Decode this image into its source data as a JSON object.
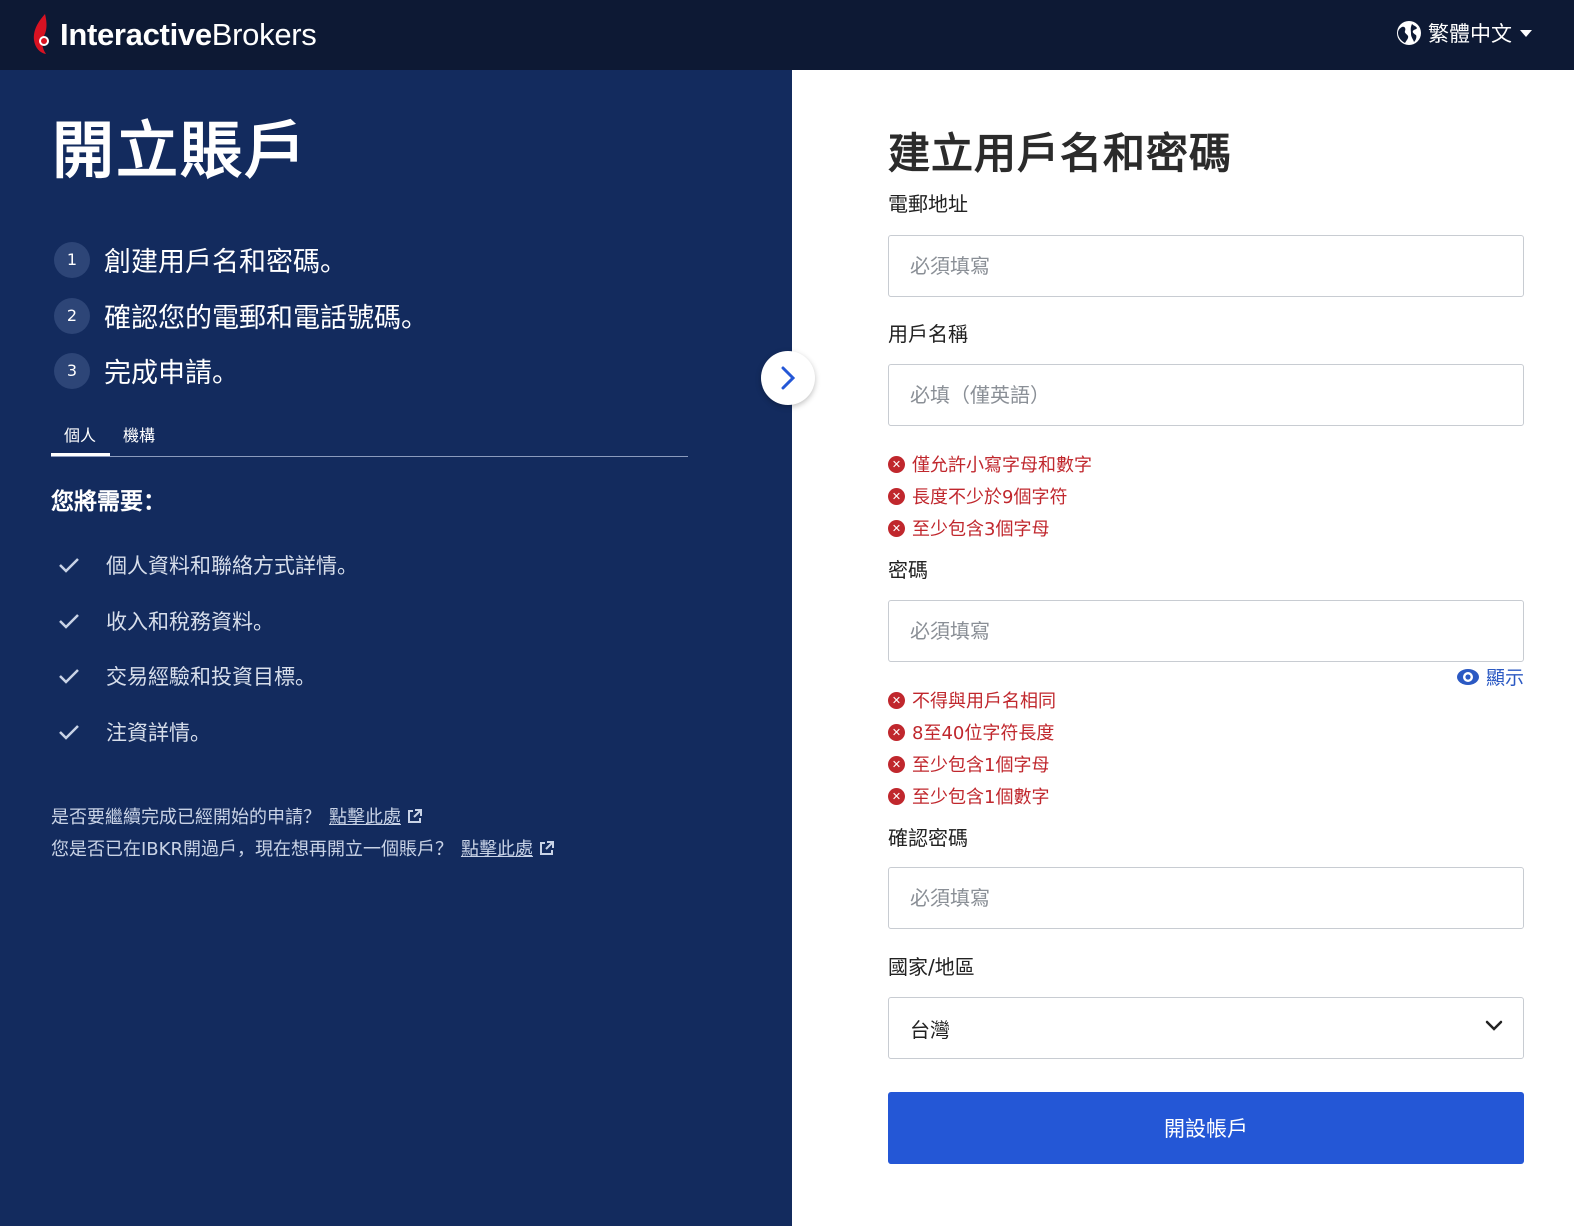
{
  "header": {
    "brand_part1": "Interactive",
    "brand_part2": "Brokers",
    "language": "繁體中文"
  },
  "left": {
    "title": "開立賬戶",
    "steps": [
      {
        "num": "1",
        "text": "創建用戶名和密碼。"
      },
      {
        "num": "2",
        "text": "確認您的電郵和電話號碼。"
      },
      {
        "num": "3",
        "text": "完成申請。"
      }
    ],
    "tabs": [
      {
        "label": "個人",
        "active": true
      },
      {
        "label": "機構",
        "active": false
      }
    ],
    "need_title": "您將需要：",
    "needs": [
      "個人資料和聯絡方式詳情。",
      "收入和稅務資料。",
      "交易經驗和投資目標。",
      "注資詳情。"
    ],
    "links": [
      {
        "text": "是否要繼續完成已經開始的申請？",
        "link": "點擊此處"
      },
      {
        "text": "您是否已在IBKR開過戶，現在想再開立一個賬戶？",
        "link": "點擊此處"
      }
    ]
  },
  "form": {
    "title": "建立用戶名和密碼",
    "email_label": "電郵地址",
    "email_placeholder": "必須填寫",
    "username_label": "用戶名稱",
    "username_placeholder": "必填（僅英語）",
    "username_errors": [
      "僅允許小寫字母和數字",
      "長度不少於9個字符",
      "至少包含3個字母"
    ],
    "password_label": "密碼",
    "password_placeholder": "必須填寫",
    "show_label": "顯示",
    "password_errors": [
      "不得與用戶名相同",
      "8至40位字符長度",
      "至少包含1個字母",
      "至少包含1個數字"
    ],
    "confirm_label": "確認密碼",
    "confirm_placeholder": "必須填寫",
    "country_label": "國家/地區",
    "country_value": "台灣",
    "submit_label": "開設帳戶"
  },
  "colors": {
    "topbar": "#0d1934",
    "left_panel": "#132b5e",
    "primary": "#2457d6",
    "error": "#c0272d"
  }
}
